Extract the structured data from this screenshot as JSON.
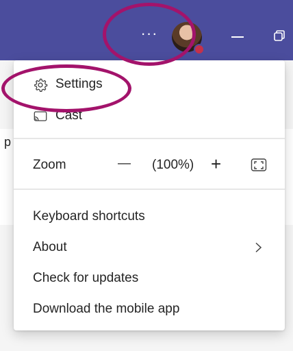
{
  "titlebar": {
    "more_label": "···",
    "colors": {
      "bar": "#4b4d9d",
      "presence": "#c4314b"
    },
    "icons": [
      "more-icon",
      "avatar",
      "minimize-icon",
      "restore-icon"
    ]
  },
  "background": {
    "partial_text": "p"
  },
  "menu": {
    "settings": {
      "label": "Settings",
      "icon": "gear-icon"
    },
    "cast": {
      "label": "Cast",
      "icon": "cast-icon"
    },
    "zoom": {
      "label": "Zoom",
      "minus": "—",
      "value": "(100%)",
      "plus": "+",
      "fullscreen_icon": "fullscreen-icon"
    },
    "items": [
      {
        "label": "Keyboard shortcuts"
      },
      {
        "label": "About",
        "has_submenu": true
      },
      {
        "label": "Check for updates"
      },
      {
        "label": "Download the mobile app"
      }
    ]
  },
  "annotations": {
    "color": "#a3136b",
    "targets": [
      "more-options",
      "settings"
    ]
  }
}
